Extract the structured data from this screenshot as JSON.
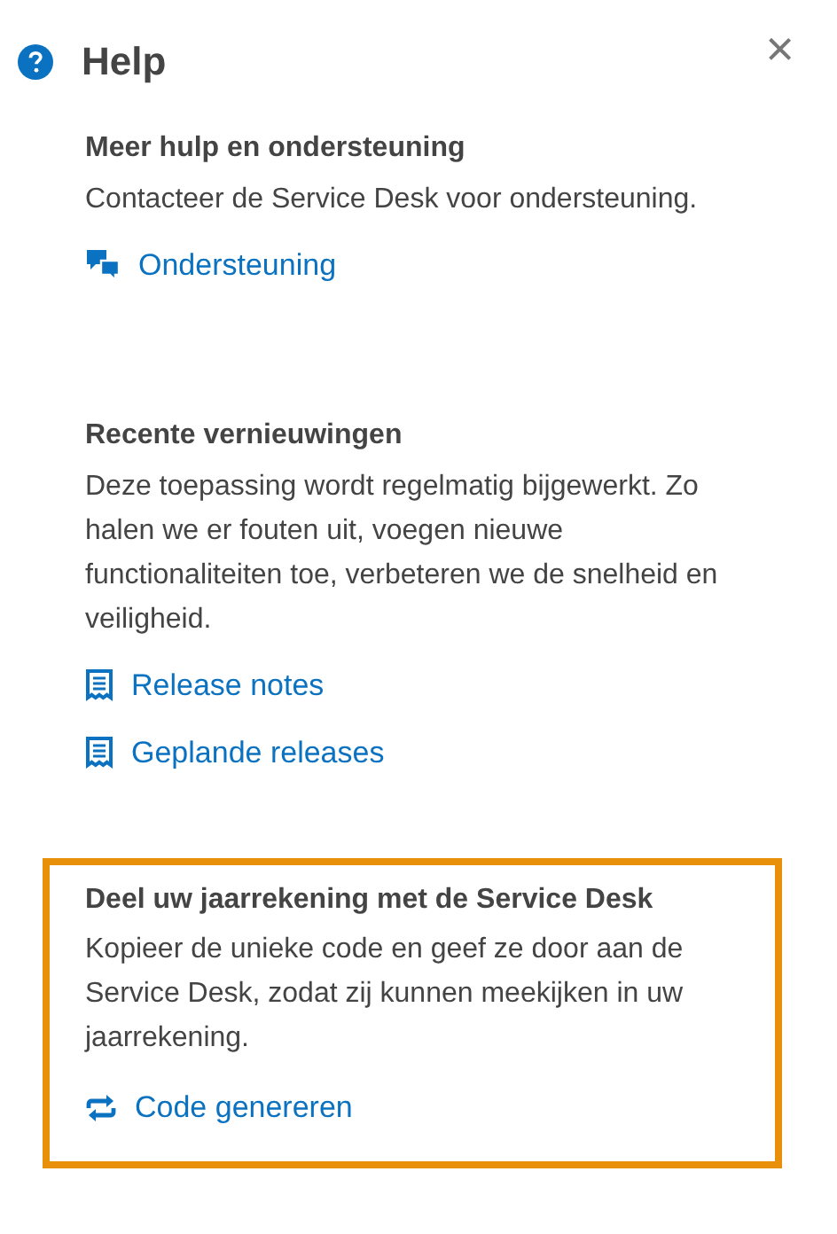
{
  "title": "Help",
  "close_label": "×",
  "sections": [
    {
      "title": "Meer hulp en ondersteuning",
      "text": "Contacteer de Service Desk voor ondersteuning.",
      "highlighted": false,
      "links": [
        {
          "label": "Ondersteuning",
          "kind": "chat"
        }
      ]
    },
    {
      "title": "Recente vernieuwingen",
      "text": "Deze toepassing wordt regelmatig bijgewerkt. Zo halen we er fouten uit, voegen nieuwe functionaliteiten toe, verbeteren we de snelheid en veiligheid.",
      "highlighted": false,
      "links": [
        {
          "label": "Release notes",
          "kind": "receipt"
        },
        {
          "label": "Geplande releases",
          "kind": "receipt"
        }
      ]
    },
    {
      "title": "Deel uw jaarrekening met de Service Desk",
      "text": "Kopieer de unieke code en geef ze door aan de Service Desk, zodat zij kunnen meekijken in uw jaarrekening.",
      "highlighted": true,
      "links": [
        {
          "label": "Code genereren",
          "kind": "sync"
        }
      ]
    }
  ]
}
